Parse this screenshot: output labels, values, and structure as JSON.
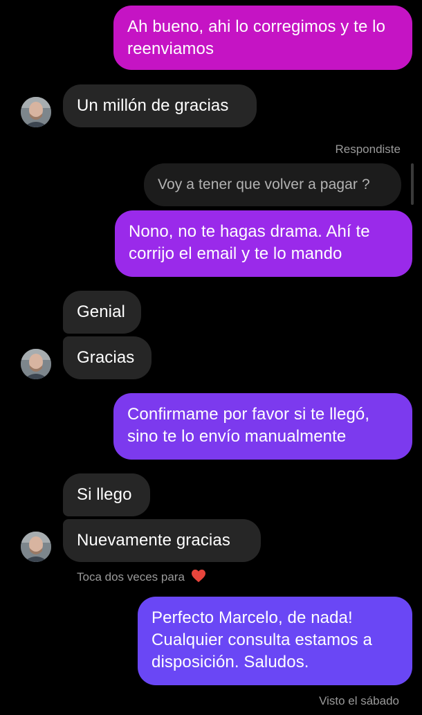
{
  "colors": {
    "background": "#000000",
    "incoming_bubble": "#262626",
    "reply_quote_bubble": "#1c1c1c",
    "meta_text": "#9a9a9a",
    "heart": "#e8453c",
    "gradient_pink": "#c514c4",
    "gradient_violet": "#8a2ee8",
    "gradient_blue": "#6a47f5"
  },
  "contact": {
    "avatar_icon": "profile-photo"
  },
  "messages": {
    "m1": "Ah bueno, ahi lo corregimos y te lo reenviamos",
    "m2": "Un millón de gracias",
    "reply_label": "Respondiste",
    "reply_quote": "Voy a tener que volver a pagar ?",
    "m3": "Nono, no te hagas drama. Ahí te corrijo el email y te lo mando",
    "m4": "Genial",
    "m5": "Gracias",
    "m6": "Confirmame por favor si te llegó, sino te lo envío manualmente",
    "m7": "Si llego",
    "m8": "Nuevamente gracias",
    "double_tap_hint": "Toca dos veces para",
    "double_tap_icon": "heart-icon",
    "m9": "Perfecto Marcelo, de nada! Cualquier consulta estamos a disposición. Saludos.",
    "seen_status": "Visto el sábado"
  }
}
